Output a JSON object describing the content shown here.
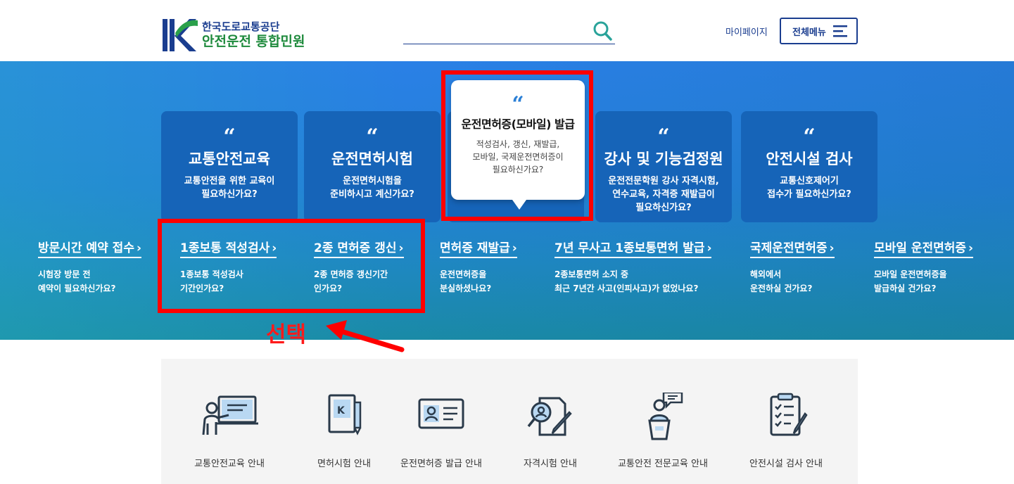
{
  "header": {
    "logo_line1": "한국도로교통공단",
    "logo_line2": "안전운전 통합민원",
    "search_placeholder": "",
    "mypage": "마이페이지",
    "allmenu": "전체메뉴"
  },
  "cards": [
    {
      "title": "교통안전교육",
      "desc1": "교통안전을 위한 교육이",
      "desc2": "필요하신가요?",
      "desc3": ""
    },
    {
      "title": "운전면허시험",
      "desc1": "운전면허시험을",
      "desc2": "준비하시고 계신가요?",
      "desc3": ""
    },
    {
      "title": "운전면허증(모바일) 발급",
      "desc1": "적성검사, 갱신, 재발급,",
      "desc2": "모바일, 국제운전면허증이",
      "desc3": "필요하신가요?"
    },
    {
      "title": "강사 및 기능검정원",
      "desc1": "운전전문학원 강사 자격시험,",
      "desc2": "연수교육, 자격증 재발급이",
      "desc3": "필요하신가요?"
    },
    {
      "title": "안전시설 검사",
      "desc1": "교통신호제어기",
      "desc2": "접수가 필요하신가요?",
      "desc3": ""
    }
  ],
  "quote_glyph": "“",
  "chevron": "›",
  "links": [
    {
      "title": "방문시간 예약 접수",
      "desc1": "시험장 방문 전",
      "desc2": "예약이 필요하신가요?"
    },
    {
      "title": "1종보통 적성검사",
      "desc1": "1종보통 적성검사",
      "desc2": "기간인가요?"
    },
    {
      "title": "2종 면허증 갱신",
      "desc1": "2종 면허증 갱신기간",
      "desc2": "인가요?"
    },
    {
      "title": "면허증 재발급",
      "desc1": "운전면허증을",
      "desc2": "분실하셨나요?"
    },
    {
      "title": "7년 무사고 1종보통면허 발급",
      "desc1": "2종보통면허 소지 중",
      "desc2": "최근 7년간 사고(인피사고)가 없었나요?"
    },
    {
      "title": "국제운전면허증",
      "desc1": "해외에서",
      "desc2": "운전하실 건가요?"
    },
    {
      "title": "모바일 운전면허증",
      "desc1": "모바일 운전면허증을",
      "desc2": "발급하실 건가요?"
    }
  ],
  "annotation": {
    "text": "선택",
    "color": "#ff0000"
  },
  "quick_menu": [
    {
      "label": "교통안전교육 안내",
      "icon": "lecture-icon"
    },
    {
      "label": "면허시험 안내",
      "icon": "license-book-icon"
    },
    {
      "label": "운전면허증 발급 안내",
      "icon": "id-card-icon"
    },
    {
      "label": "자격시험 안내",
      "icon": "exam-magnifier-icon"
    },
    {
      "label": "교통안전 전문교육 안내",
      "icon": "speaker-podium-icon"
    },
    {
      "label": "안전시설 검사 안내",
      "icon": "checklist-icon"
    }
  ],
  "colors": {
    "navy": "#1a3d8f",
    "green": "#1e8a3c",
    "banner": "#2380d8",
    "card": "#1664b8",
    "highlight": "#ff0000"
  }
}
